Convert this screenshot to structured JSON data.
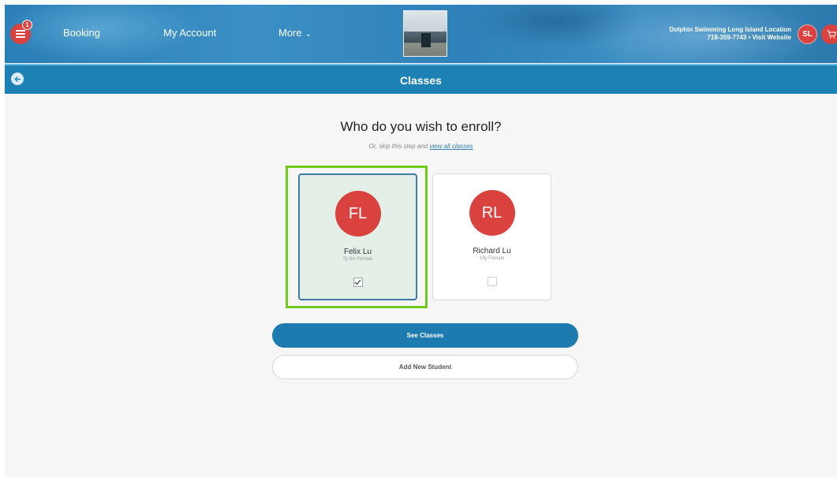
{
  "header": {
    "menu_badge": "1",
    "nav": {
      "booking": "Booking",
      "my_account": "My Account",
      "more": "More"
    },
    "location_name": "Dolphin Swimming Long Island Location",
    "location_contact": "718-359-7743 • Visit Website",
    "user_initials": "SL"
  },
  "titlebar": {
    "title": "Classes"
  },
  "main": {
    "heading": "Who do you wish to enroll?",
    "skip_prefix": "Or, skip this step and",
    "skip_link": "view all classes",
    "students": [
      {
        "initials": "FL",
        "name": "Felix Lu",
        "meta": "7y 9m Female",
        "checked": true
      },
      {
        "initials": "RL",
        "name": "Richard Lu",
        "meta": "13y Female",
        "checked": false
      }
    ],
    "see_classes_label": "See Classes",
    "add_student_label": "Add New Student"
  },
  "colors": {
    "brand_blue": "#1e81b3",
    "accent_red": "#d9423f",
    "highlight_green": "#6fca1c",
    "selected_card_bg": "#e4efe8"
  },
  "icons": {
    "menu": "hamburger-icon",
    "back": "arrow-left-icon",
    "cart": "cart-icon",
    "check": "checkmark-icon",
    "more": "chevron-down-icon"
  }
}
